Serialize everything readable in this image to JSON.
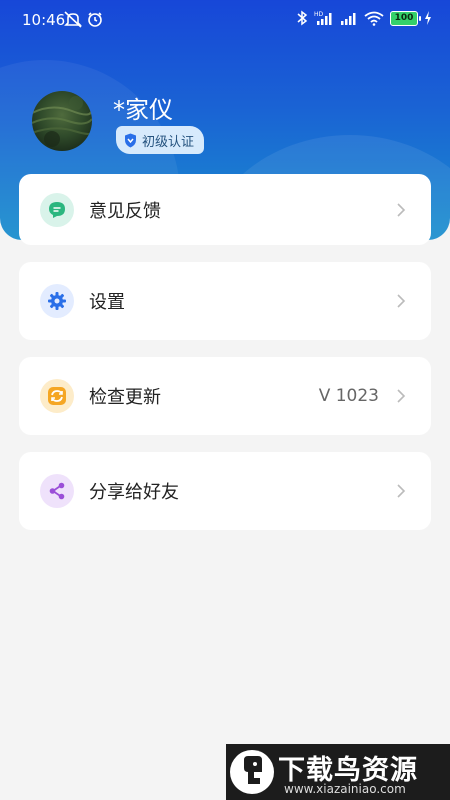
{
  "status_bar": {
    "time": "10:46",
    "battery": "100"
  },
  "profile": {
    "name": "*家仪",
    "badge": "初级认证"
  },
  "menu": [
    {
      "label": "意见反馈",
      "value": "",
      "icon": "feedback-icon",
      "icon_bg": "#d9f3ea",
      "icon_color": "#2bb67f"
    },
    {
      "label": "设置",
      "value": "",
      "icon": "gear-icon",
      "icon_bg": "#e3ecff",
      "icon_color": "#2a6fe8"
    },
    {
      "label": "检查更新",
      "value": "V 1023",
      "icon": "update-icon",
      "icon_bg": "#fdecc9",
      "icon_color": "#f5a623"
    },
    {
      "label": "分享给好友",
      "value": "",
      "icon": "share-icon",
      "icon_bg": "#efe2fb",
      "icon_color": "#9b4fd8"
    }
  ],
  "watermark": {
    "title": "下载鸟资源",
    "url": "www.xiazainiao.com"
  },
  "colors": {
    "header_top": "#1747d8",
    "header_bottom": "#1a8fce",
    "background": "#f4f4f4"
  }
}
